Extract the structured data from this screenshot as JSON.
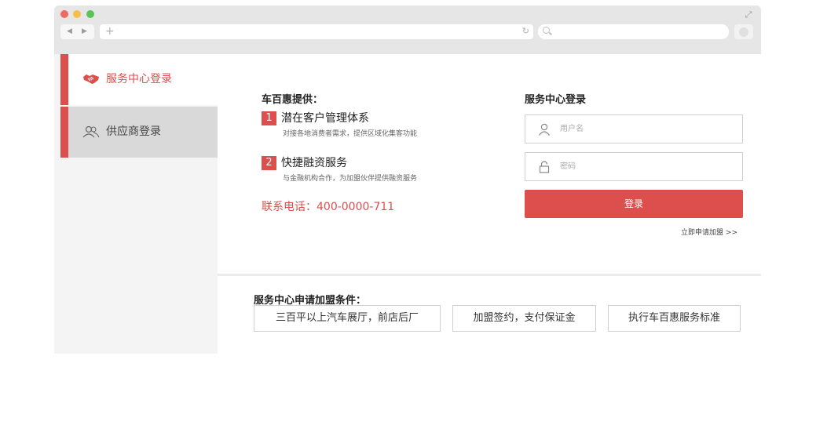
{
  "sidebar": {
    "items": [
      {
        "label": "服务中心登录",
        "icon": "handshake-icon",
        "active": true
      },
      {
        "label": "供应商登录",
        "icon": "users-icon",
        "active": false
      }
    ]
  },
  "intro": {
    "title": "车百惠提供：",
    "features": [
      {
        "num": "1",
        "title": "潜在客户管理体系",
        "desc": "对接各地消费者需求，提供区域化集客功能"
      },
      {
        "num": "2",
        "title": "快捷融资服务",
        "desc": "与金融机构合作，为加盟伙伴提供融资服务"
      }
    ],
    "phone": "联系电话：400-0000-711"
  },
  "login": {
    "title": "服务中心登录",
    "username_placeholder": "用户名",
    "password_placeholder": "密码",
    "submit_label": "登录",
    "apply_link": "立即申请加盟 >>"
  },
  "conditions": {
    "title": "服务中心申请加盟条件：",
    "items": [
      "三百平以上汽车展厅，前店后厂",
      "加盟签约，支付保证金",
      "执行车百惠服务标准"
    ]
  },
  "colors": {
    "accent": "#dc4f4d",
    "sidebar_bg": "#f4f4f4",
    "inactive_tab": "#d9d9d9"
  }
}
